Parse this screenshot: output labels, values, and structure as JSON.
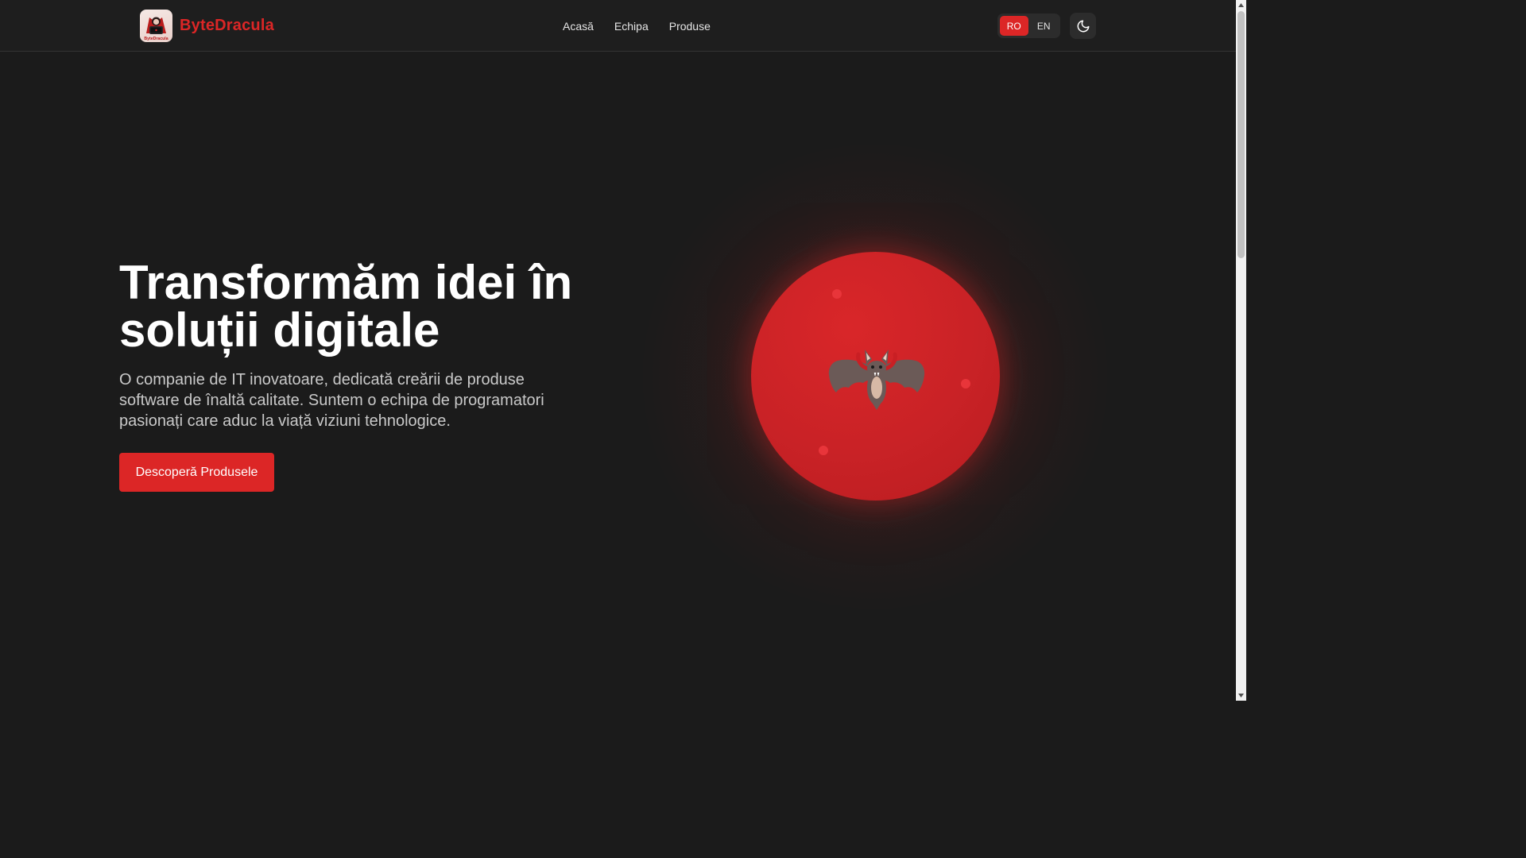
{
  "colors": {
    "accent": "#dc2626",
    "background": "#1b1b1b",
    "header_background": "#1e1e1e"
  },
  "header": {
    "brand_name": "ByteDracula",
    "logo_text": "ByteDracula",
    "nav": [
      {
        "label": "Acasă"
      },
      {
        "label": "Echipa"
      },
      {
        "label": "Produse"
      }
    ],
    "language": {
      "options": [
        "RO",
        "EN"
      ],
      "selected": "RO"
    },
    "theme_icon": "moon-icon"
  },
  "hero": {
    "title": "Transformăm idei în soluții digitale",
    "description": "O companie de IT inovatoare, dedicată creării de produse software de înaltă calitate. Suntem o echipa de programatori pasionați care aduc la viață viziuni tehnologice.",
    "cta_label": "Descoperă Produsele",
    "illustration_icon": "bat-icon"
  }
}
